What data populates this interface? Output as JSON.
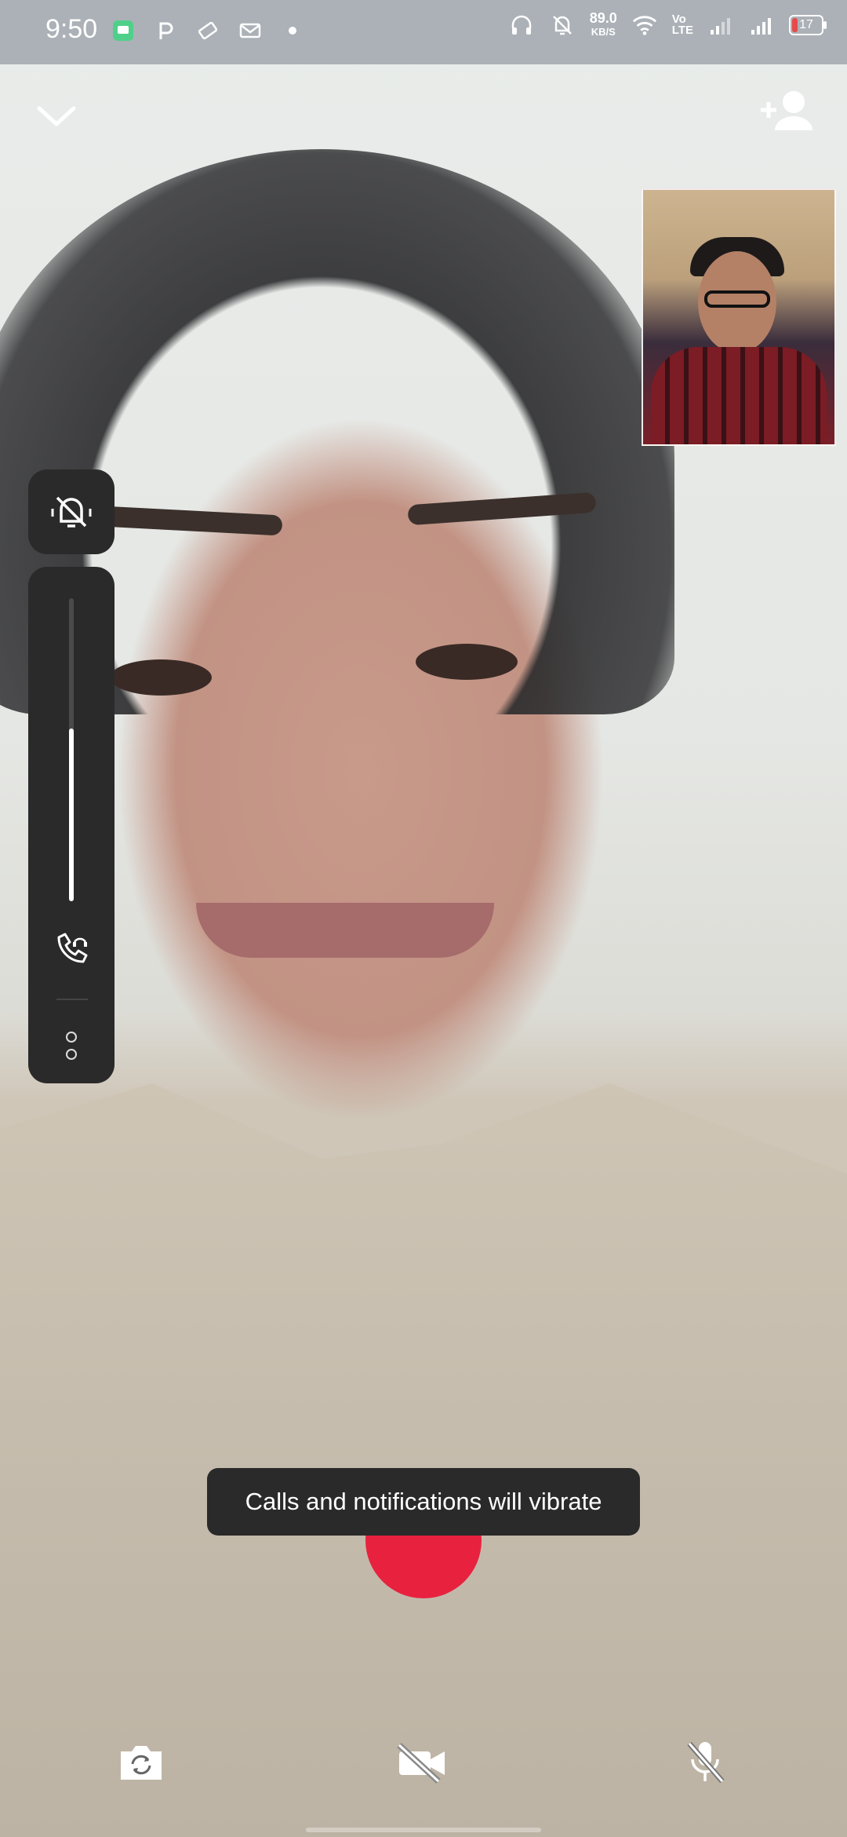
{
  "status_bar": {
    "time": "9:50",
    "left_icons": [
      "chat-app-icon",
      "p-app-icon",
      "tag-icon",
      "mail-icon",
      "dot-icon"
    ],
    "net_speed_value": "89.0",
    "net_speed_unit": "KB/S",
    "volte_line1": "Vo",
    "volte_line2": "LTE",
    "battery_level": "17",
    "right_icons": [
      "headphones-icon",
      "bell-off-icon",
      "wifi-icon",
      "signal-icon",
      "signal-icon"
    ]
  },
  "top_controls": {
    "collapse": "chevron-down-icon",
    "add_participant": "add-person-icon"
  },
  "volume_panel": {
    "mute_icon": "bell-off-icon",
    "volume_fraction": 0.57,
    "call_volume_icon": "phone-headset-icon",
    "more_icon": "more-options-icon"
  },
  "toast": {
    "message": "Calls and notifications will vibrate"
  },
  "call_controls": {
    "end_call_color": "#e8213f",
    "flip_camera": "flip-camera-icon",
    "video": "video-off-icon",
    "mic": "mic-off-icon"
  }
}
